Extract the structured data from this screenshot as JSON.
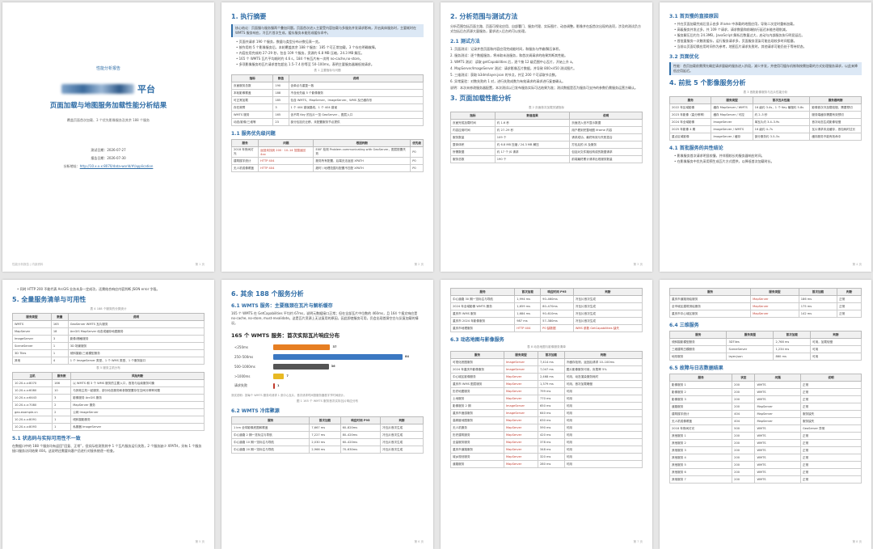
{
  "p1": {
    "label": "性能分析报告",
    "title_suffix": "平台",
    "subtitle": "页面加载与地图服务加载性能分析结果",
    "desc": "覆盖页面首次加载、3 个优先影像服务及其余 188 个服务",
    "test_date": "测试日期：2026-07-27",
    "report_date": "报告日期：2026-07-30",
    "url_label": "分析地址：",
    "url": "http://10.x.x.x:8070/data-world/#/application",
    "footer_left": "性能分析报告 | 内部资料",
    "footer_right": "第 1 页"
  },
  "p2": {
    "h1": "1. 执行摘要",
    "hl": "核心结论：页面慢与服务慢两个叠加问题。页面首次进入主要受内容加载与多服务并发请求影响，开启具体服务时，主要耗时在 WMTS 服务响应，冷瓦片首次生成，缓存服务未能形成缓存命中。",
    "bullets": [
      "页面共请求 190 个服务，数量与类型分布计数见表一览。",
      "按作用的 5 个影像服务后，本轮覆盖其余 188 个服务：185 个可正常加载，3 个存在明确故障。",
      "内容应用完成的 27–29 秒，包含 109 个服务，资源约 6.8 MB 压缩，24.3 MB 解压。",
      "165 个 WMTS 瓦片平均耗时约 4.6 s，184 个有瓦片有一次附 no-cache,no-store。",
      "多项影像服务的瓦片请求首包超出 1.5–7.4 秒等至 50–100ms，表明主要服务器端低效请求。"
    ],
    "cap1": "表 1 主要指标与问题",
    "t1_head": [
      "指标",
      "数值",
      "说明"
    ],
    "t1_rows": [
      [
        "页面服务总数",
        "190",
        "含单点与重复一致"
      ],
      [
        "本轮影像覆盖",
        "188",
        "不含优先级 5 个影像服务"
      ],
      [
        "可正常加载",
        "185",
        "包含 WMTS、MapServer、ImageServer、WMS 及已缓存形"
      ],
      [
        "存在故障",
        "3",
        "1 个 404 错误路线、1 个 404 错误"
      ],
      [
        "WMTS 服务",
        "165",
        "含不同 Key 的瓦片一览 GeoServer 、图层入口"
      ],
      [
        "动态/影像/三维等",
        "23",
        "部分包括仍迁移，未配置服务节点提供"
      ]
    ],
    "h2": "1.1 服务优先级问题",
    "t2_head": [
      "服务",
      "问题",
      "根因判断",
      "优先级"
    ],
    "t2_rows": [
      [
        "2018 年夜间灯光",
        "返回未找到 200 · 10–14 范围返回 4xx",
        "EXIF 检测 Problem communicating with GeoServer，图层配置失效",
        "P0"
      ],
      [
        "建筑楼宇统计",
        "HTTP 404",
        "服务所有配置，后端无法返回 XPATH",
        "P0"
      ],
      [
        "无人机成像覆盖",
        "HTTP 404",
        "超时 / 地理范围与配置不匹配 XPATH",
        "P0"
      ]
    ],
    "footer_right": "第 2 页"
  },
  "p3": {
    "h1": "2. 分析范围与测试方法",
    "intro": "分析范围包括页面主路、页面可视化应用、自部署门、服务代理、实际图片、动态调整。影像并在起首次出现的选项，涉及的测试负方式包括后台资源大量服务，要求进入后台的可以处理。",
    "h2": "2.1 测试方法",
    "items": [
      "1. 页面测试：记录并首页面和内容应用完成能时间，和服务与传输/解压体积。",
      "2. 服务测试：逐个数据服务，将未取未选服务，和首次调请求的结果判断其性能。",
      "3. WMTS 测试：读取 getCapabilities 后，逐个按 12 级范围中心瓦片，开始上升 a。",
      "4. MapServer/ImageServer 测试：请求影像瓦片数据，并导致 800×450 测试图片。",
      "5. 三维测试：获取 b3dm/layer.json 的节点，并至 200 个可读取节点数。",
      "6. 异常复验：对数失败的 1 对，进行失败成数为有效请求的请求进行复查确认。"
    ],
    "note": "说明：本次未修改服务器配置，本次测试以已发布服务实际可达结果为准；测试数据是否为服务可支持的参数仍需服务运营方确认。",
    "h1b": "3. 页面加载性能分析",
    "cap": "表 2 页面首次加载关键指标",
    "t_head": [
      "指标",
      "数值结果",
      "说明"
    ],
    "t_rows": [
      [
        "页面完成加载时间",
        "约 1.6 秒",
        "页面进入但不显示数据"
      ],
      [
        "内容应用时间",
        "约 27–29 秒",
        "用户看到完整地图 iframe 内容"
      ],
      [
        "服务数量",
        "109 个",
        "请求成功，最终有效与失败混合"
      ],
      [
        "整体体积",
        "约 6.8 MB 压缩 / 24.3 MB 解压",
        "打包后的 JS 及服务"
      ],
      [
        "所需数据",
        "约 17 个 JS 请求",
        "包括对文件路径构成的数据请求"
      ],
      [
        "服务总数",
        "190 个",
        "前端最终累计请求出现服务数量"
      ]
    ],
    "footer_right": "第 3 页"
  },
  "p4": {
    "h2a": "3.1 首页慢的直接原因",
    "bullets_a": [
      "共在页面加载完成后显示由多 iframe 中承载的地图应用，导致二次定时重新加载。",
      "高级服务并发过多，共 109 个请求，请求数量和前端执行延迟未能合理削减。",
      "服务解压后约为 24.3MB，JavaScript 解析后数量过大，启动与内部服务执行明显延后。",
      "首批量服务一次触发缓存，运行服务请求多，页面服务渲染可能出现较多时间阻塞。",
      "当前以页面切换应用时间作为参考，地图瓦片请求失败时，其他请求可能仍处于等待状态。"
    ],
    "h2b": "3.2 页面优化",
    "hl": "性能：首页加载前需预先确定请求量级的服务进入阶段，减少并发，并使用可缓存机制和按需加载的方式处理服务请求，以此来降低应用延迟。",
    "h1": "4. 前批 5 个影像服务分析",
    "cap": "表 3 首批影像服务与瓦片性能分析",
    "t_head": [
      "服务",
      "服务类型",
      "首次瓦片性能",
      "服务器判断"
    ],
    "t_rows": [
      [
        "2022 年区域影像",
        "缓存 MapServer / WMTS",
        "16 级约 3.4s，1 个 Key 最慢约 5.8s",
        "影像首次冷加载较慢，需要预切"
      ],
      [
        "2023 年影像（高分辨率）",
        "缓存 MapServer / 可控",
        "约 2–3 秒",
        "服务端缓存需要有效预切"
      ],
      [
        "2024 年全域影像",
        "ImageServer",
        "单瓦片约 3.4–3.9s",
        "首次动态生成影像较慢"
      ],
      [
        "2025 年影像 4 期",
        "ImageServer / WMTS",
        "16 级约 4–7s",
        "瓦片请求未走缓存，首包耗时过长"
      ],
      [
        "重点区域影像",
        "ImageServer / 缓存",
        "部分服务约 3.5–5s",
        "缓存服务不能有效命中"
      ]
    ],
    "h2c": "4.1 首批服务的共性结论",
    "bullets_c": [
      "影像服务首次请求明显较慢，并伴随较长的服务器响应时间。",
      "在影像服务中优先采用预生成瓦片方式提供，以降低首次加载时长。"
    ],
    "footer_right": "第 4 页"
  },
  "p5": {
    "top_bullet": "同时 HTTP 200 不能代表 ArcGIS 业务本身一定成功，还需结合响应内容判断 JSON error 字段。",
    "h1": "5. 全量服务清单与可用性",
    "cap1": "表 4 188 个服务的分类统计",
    "t1_head": [
      "服务类型",
      "数量",
      "说明"
    ],
    "t1_rows": [
      [
        "WMTS",
        "165",
        "GeoServer WMTS 瓦片服务"
      ],
      [
        "MapServer",
        "18",
        "ArcGIS MapServer 动态或缓存地图服务"
      ],
      [
        "ImageServer",
        "3",
        "影像/栅格服务"
      ],
      [
        "SceneServer",
        "1",
        "3D 场景服务"
      ],
      [
        "3D Tiles",
        "1",
        "倾斜摄影/三维模型服务"
      ],
      [
        "其他",
        "4",
        "1 个 ImageServer 类型、1 个 WMS 类型、1 个服务接口"
      ]
    ],
    "cap2": "表 5 服务主机分布",
    "t2_head": [
      "主机",
      "服务数",
      "风险判断"
    ],
    "t2_rows": [
      [
        "10.20.x.x:8070",
        "166",
        "以 WMTS 和 3 个 WMS 服务的主要入口，首批与后续服务均衡"
      ],
      [
        "10.20.x.x:6080",
        "10",
        "与其他主机一起服务，部分动态服务和参数配置存在空间分辨率问题"
      ],
      [
        "10.20.x.x:6443",
        "3",
        "影像服务 ArcGIS 服务"
      ],
      [
        "10.20.x.x:7080",
        "2",
        "MapServer 服务"
      ],
      [
        "geo.example.cn",
        "2",
        "公网 ImageServer"
      ],
      [
        "10.20.x.x:8091",
        "1",
        "倾斜摄影服务"
      ],
      [
        "10.20.x.x:8093",
        "1",
        "私服器 ImageServer"
      ]
    ],
    "h2": "5.1 状态码与实际可用性不一致",
    "txt": "在数据口中的 188 个服务均有返回“回复、正常”，但实际检测到其中 1 个瓦片服务运行失败，2 个服务缺少 XPATH，另有 1 个服务接口服务访问结果 404。这说明还需要向客户员进行对接系统逐一检查。",
    "footer_right": "第 5 页"
  },
  "p6": {
    "h1": "6. 其余 188 个服务分析",
    "h2a": "6.1 WMTS 服务：主要瓶颈在瓦片与解析缓存",
    "txt": "165 个 WMTS 在 GetCapabilities 平均约 67ms，说明元数据接口正常；但在全部瓦片中位数的 460ms，且 164 个报文响应是 no-cache, no-store, must-revalidate。这是瓦片资源上无法复用的原因，因此即使服务可用，仍会出现首屏空白与反复加载的情况。",
    "chart_title": "165 个 WMTS 服务：首次实际瓦片响应分布",
    "chart_data": {
      "type": "bar",
      "categories": [
        "<250ms",
        "250–500ms",
        "500–1000ms",
        ">1000ms",
        "请求失败"
      ],
      "values": [
        37,
        84,
        36,
        7,
        1
      ],
      "colors": [
        "#e67e22",
        "#3b78c2",
        "#555555",
        "#e8b923",
        "#c0392b"
      ],
      "title": "165 个 WMTS 服务：首次实际瓦片响应分布"
    },
    "chart_note": "测试说明：按每个 WMTS 服务均请求 1 张中心瓦片，首次请求时间按服务器首字节时间统计。",
    "cap": "图 1 165 个 WMTS 服务首次实际瓦片响应分布",
    "h2b": "6.2 WMTS 冷库聚源",
    "t_head": [
      "服务",
      "首次加载",
      "响应时间 P95",
      "判断"
    ],
    "t_rows": [
      [
        "1 km 全球影像底图和覆盖",
        "7,667 ms",
        "60–820ms",
        "冷瓦片首次生成"
      ],
      [
        "中心道路 2 期一览标注与导航",
        "7,227 ms",
        "80–420ms",
        "冷瓦片首次生成"
      ],
      [
        "中心道路 10 期一览标注与导航",
        "2,030 ms",
        "60–420ms",
        "冷瓦片首次生成"
      ],
      [
        "中心道路 20 期一览标注与导航",
        "2,966 ms",
        "70–630ms",
        "冷瓦片首次生成"
      ]
    ],
    "footer_right": "第 6 页"
  },
  "p7": {
    "t1_head": [
      "服务",
      "首次加载",
      "响应时间 P95",
      "判断"
    ],
    "t1_rows": [
      [
        "中心道路 30 期一览标注与导航",
        "1,994 ms",
        "90–460ms",
        "冷瓦片首次生成"
      ],
      [
        "2024 年全域影像 WMTS 服务",
        "1,659 ms",
        "80–470ms",
        "冷瓦片首次生成"
      ],
      [
        "重庆市 WMS 服务",
        "1,684 ms",
        "90–610ms",
        "冷瓦片首次生成"
      ],
      [
        "重庆市 2024 年影像服务",
        "987 ms",
        "57–380ms",
        "冷瓦片首次生成"
      ],
      [
        "重庆市地理服务",
        "HTTP 404",
        "P0 缺数据",
        "WMS 参数 GetCapabilities 缺失"
      ]
    ],
    "h2": "6.3 动态地图与影像服务",
    "cap": "表 8 动态地图与影像服务清单",
    "t2_head": [
      "服务",
      "服务类型",
      "首次加载",
      "判断"
    ],
    "t2_rows": [
      [
        "可视化底图服务",
        "ImageServer",
        "7,414 ms",
        "冷缓存检测，返回后请求 10–100ms"
      ],
      [
        "2024 年重庆市影像服务",
        "ImageServer",
        "7,047 ms",
        "图片影像服务可用，负载率 5%"
      ],
      [
        "中心城区影像服务",
        "MapServer",
        "2,468 ms",
        "可用，动态渲染服务耗时"
      ],
      [
        "重庆市 WMS 图层服务",
        "MapServer",
        "1,379 ms",
        "可用，首次加载略慢"
      ],
      [
        "历史地图服务",
        "MapServer",
        "799 ms",
        "可用"
      ],
      [
        "土地服务",
        "MapServer",
        "770 ms",
        "可用"
      ],
      [
        "影像服务 2 期",
        "ImageServer",
        "650 ms",
        "可用"
      ],
      [
        "重庆市遥感服务",
        "ImageServer",
        "640 ms",
        "可用"
      ],
      [
        "高精度地图服务",
        "MapServer",
        "630 ms",
        "可用"
      ],
      [
        "无人机服务",
        "MapServer",
        "590 ms",
        "可用"
      ],
      [
        "历史建筑服务",
        "MapServer",
        "420 ms",
        "可用"
      ],
      [
        "全量服务服务",
        "MapServer",
        "378 ms",
        "可用"
      ],
      [
        "重庆市道路服务",
        "MapServer",
        "348 ms",
        "可用"
      ],
      [
        "城乡规划服务",
        "MapServer",
        "320 ms",
        "可用"
      ],
      [
        "道路服务",
        "MapServer",
        "280 ms",
        "可用"
      ]
    ],
    "footer_right": "第 7 页"
  },
  "p8": {
    "t1_head": [
      "服务",
      "服务类型",
      "首次加载",
      "判断"
    ],
    "t1_rows": [
      [
        "重庆市道路测绘服务",
        "MapServer",
        "186 ms",
        "正常"
      ],
      [
        "全市城区建筑测绘服务",
        "MapServer",
        "175 ms",
        "正常"
      ],
      [
        "重庆市中心城区服务",
        "MapServer",
        "142 ms",
        "正常"
      ]
    ],
    "h2a": "6.4 三维服务",
    "t2_head": [
      "服务",
      "服务类型",
      "首次加载",
      "判断"
    ],
    "t2_rows": [
      [
        "倾斜摄影模型服务",
        "3DTiles",
        "2,768 ms",
        "可用，加载较慢"
      ],
      [
        "三维建筑白模服务",
        "SceneServer",
        "1,234 ms",
        "可用"
      ],
      [
        "地形服务",
        "layer.json",
        "860 ms",
        "可用"
      ]
    ],
    "h2b": "6.5 故障与日志数据结果",
    "t3_head": [
      "服务",
      "状态",
      "问题",
      "说明"
    ],
    "t3_rows": [
      [
        "影像服务 1",
        "200",
        "WMTS",
        "正常"
      ],
      [
        "影像服务 2",
        "200",
        "WMTS",
        "正常"
      ],
      [
        "影像服务 3",
        "200",
        "WMTS",
        "正常"
      ],
      [
        "道路服务",
        "200",
        "MapServer",
        "正常"
      ],
      [
        "建筑楼宇统计",
        "404",
        "MapServer",
        "服务缺失"
      ],
      [
        "无人机成像覆盖",
        "404",
        "MapServer",
        "服务缺失"
      ],
      [
        "2018 年夜间灯光",
        "500",
        "WMTS",
        "GeoServer 异常"
      ],
      [
        "其他服务 1",
        "200",
        "WMTS",
        "正常"
      ],
      [
        "其他服务 2",
        "200",
        "WMTS",
        "正常"
      ],
      [
        "其他服务 3",
        "200",
        "WMTS",
        "正常"
      ],
      [
        "其他服务 4",
        "200",
        "WMTS",
        "正常"
      ],
      [
        "其他服务 5",
        "200",
        "WMTS",
        "正常"
      ],
      [
        "其他服务 6",
        "200",
        "WMTS",
        "正常"
      ],
      [
        "其他服务 7",
        "200",
        "WMTS",
        "正常"
      ]
    ],
    "footer_right": "第 8 页"
  }
}
